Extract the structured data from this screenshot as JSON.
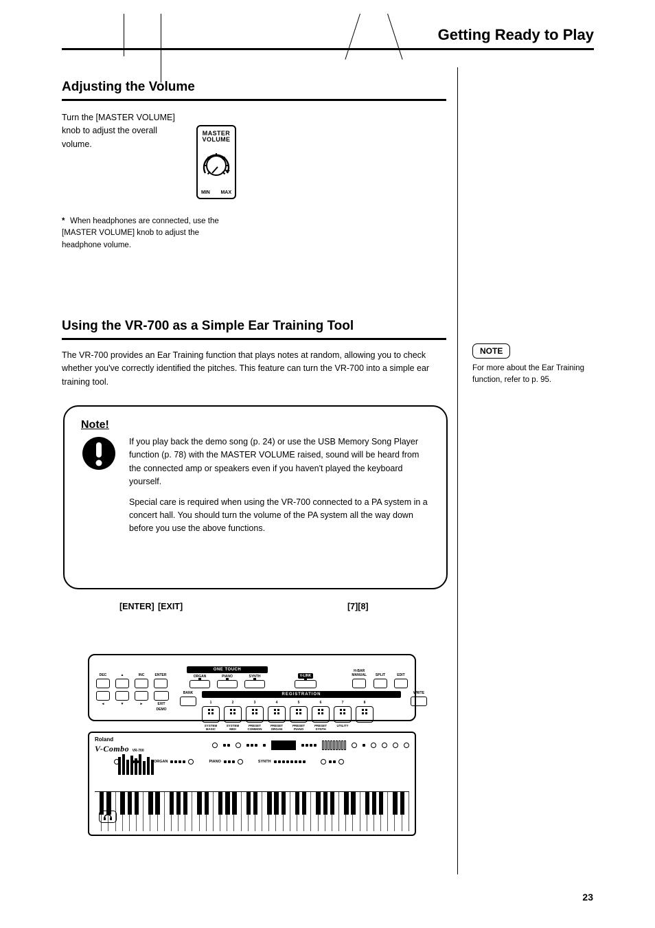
{
  "page": {
    "title": "Getting Ready to Play",
    "number": "23"
  },
  "sections": {
    "volume": {
      "heading": "Adjusting the Volume",
      "para": "Turn the [MASTER VOLUME] knob to adjust the overall volume.",
      "note_text": "When headphones are connected, use the [MASTER VOLUME] knob to adjust the headphone volume."
    },
    "ear_training": {
      "heading": "Using the VR-700 as a Simple Ear Training Tool",
      "intro": "The VR-700 provides an Ear Training function that plays notes at random, allowing you to check whether you've correctly identified the pitches. This feature can turn the VR-700 into a simple ear training tool."
    }
  },
  "knob": {
    "title_line1": "MASTER",
    "title_line2": "VOLUME",
    "min": "MIN",
    "max": "MAX"
  },
  "note_box": {
    "heading": "Note!",
    "p1": "If you play back the demo song (p. 24) or use the USB Memory Song Player function (p. 78) with the MASTER VOLUME raised, sound will be heard from the connected amp or speakers even if you haven't played the keyboard yourself.",
    "p2": "Special care is required when using the VR-700 connected to a PA system in a concert hall. You should turn the volume of the PA system all the way down before you use the above functions."
  },
  "panel": {
    "button_labels": {
      "enter": "[ENTER]",
      "exit": "[EXIT]",
      "seven_eight": "[7][8]"
    },
    "top_row": {
      "dec": "DEC",
      "inc": "INC",
      "enter": "ENTER",
      "up": "▲",
      "one_touch": "ONE TOUCH",
      "organ": "ORGAN",
      "piano": "PIANO",
      "synth": "SYNTH",
      "vlink": "V-LINK",
      "hbar_manual": "H-BAR\nMANUAL",
      "split": "SPLIT",
      "edit": "EDIT"
    },
    "lower_row": {
      "left": "◄",
      "down": "▼",
      "right": "►",
      "exit": "EXIT",
      "demo": "DEMO",
      "bank": "BANK",
      "write": "WRITE",
      "registration": "REGISTRATION",
      "numbers": [
        "1",
        "2",
        "3",
        "4",
        "5",
        "6",
        "7",
        "8"
      ],
      "sub": [
        "SYSTEM\nBASIC",
        "SYSTEM\nMIDI",
        "PRESET\nCOMMON",
        "PRESET\nORGAN",
        "PRESET\nPIANO",
        "PRESET\nSYNTH",
        "UTILITY",
        ""
      ]
    }
  },
  "keyboard": {
    "brand": "Roland",
    "model": "V-Combo",
    "model_suffix": "VR-700",
    "mid_sections": [
      "ORGAN",
      "PIANO",
      "SYNTH"
    ]
  },
  "side_note": {
    "ref": "NOTE",
    "text": "For more about the Ear Training function, refer to p. 95."
  }
}
